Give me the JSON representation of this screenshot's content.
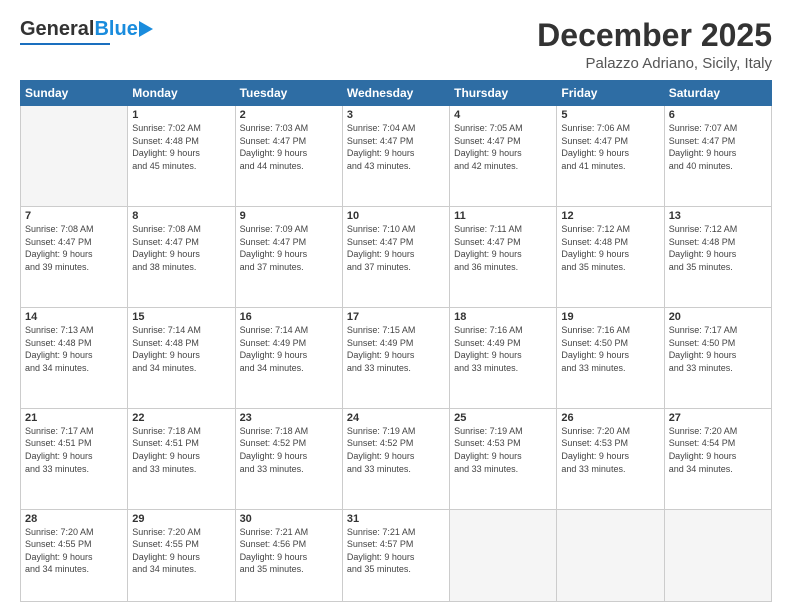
{
  "header": {
    "logo_general": "General",
    "logo_blue": "Blue",
    "month_title": "December 2025",
    "subtitle": "Palazzo Adriano, Sicily, Italy"
  },
  "calendar": {
    "days_of_week": [
      "Sunday",
      "Monday",
      "Tuesday",
      "Wednesday",
      "Thursday",
      "Friday",
      "Saturday"
    ],
    "weeks": [
      [
        {
          "day": "",
          "info": ""
        },
        {
          "day": "1",
          "info": "Sunrise: 7:02 AM\nSunset: 4:48 PM\nDaylight: 9 hours\nand 45 minutes."
        },
        {
          "day": "2",
          "info": "Sunrise: 7:03 AM\nSunset: 4:47 PM\nDaylight: 9 hours\nand 44 minutes."
        },
        {
          "day": "3",
          "info": "Sunrise: 7:04 AM\nSunset: 4:47 PM\nDaylight: 9 hours\nand 43 minutes."
        },
        {
          "day": "4",
          "info": "Sunrise: 7:05 AM\nSunset: 4:47 PM\nDaylight: 9 hours\nand 42 minutes."
        },
        {
          "day": "5",
          "info": "Sunrise: 7:06 AM\nSunset: 4:47 PM\nDaylight: 9 hours\nand 41 minutes."
        },
        {
          "day": "6",
          "info": "Sunrise: 7:07 AM\nSunset: 4:47 PM\nDaylight: 9 hours\nand 40 minutes."
        }
      ],
      [
        {
          "day": "7",
          "info": "Sunrise: 7:08 AM\nSunset: 4:47 PM\nDaylight: 9 hours\nand 39 minutes."
        },
        {
          "day": "8",
          "info": "Sunrise: 7:08 AM\nSunset: 4:47 PM\nDaylight: 9 hours\nand 38 minutes."
        },
        {
          "day": "9",
          "info": "Sunrise: 7:09 AM\nSunset: 4:47 PM\nDaylight: 9 hours\nand 37 minutes."
        },
        {
          "day": "10",
          "info": "Sunrise: 7:10 AM\nSunset: 4:47 PM\nDaylight: 9 hours\nand 37 minutes."
        },
        {
          "day": "11",
          "info": "Sunrise: 7:11 AM\nSunset: 4:47 PM\nDaylight: 9 hours\nand 36 minutes."
        },
        {
          "day": "12",
          "info": "Sunrise: 7:12 AM\nSunset: 4:48 PM\nDaylight: 9 hours\nand 35 minutes."
        },
        {
          "day": "13",
          "info": "Sunrise: 7:12 AM\nSunset: 4:48 PM\nDaylight: 9 hours\nand 35 minutes."
        }
      ],
      [
        {
          "day": "14",
          "info": "Sunrise: 7:13 AM\nSunset: 4:48 PM\nDaylight: 9 hours\nand 34 minutes."
        },
        {
          "day": "15",
          "info": "Sunrise: 7:14 AM\nSunset: 4:48 PM\nDaylight: 9 hours\nand 34 minutes."
        },
        {
          "day": "16",
          "info": "Sunrise: 7:14 AM\nSunset: 4:49 PM\nDaylight: 9 hours\nand 34 minutes."
        },
        {
          "day": "17",
          "info": "Sunrise: 7:15 AM\nSunset: 4:49 PM\nDaylight: 9 hours\nand 33 minutes."
        },
        {
          "day": "18",
          "info": "Sunrise: 7:16 AM\nSunset: 4:49 PM\nDaylight: 9 hours\nand 33 minutes."
        },
        {
          "day": "19",
          "info": "Sunrise: 7:16 AM\nSunset: 4:50 PM\nDaylight: 9 hours\nand 33 minutes."
        },
        {
          "day": "20",
          "info": "Sunrise: 7:17 AM\nSunset: 4:50 PM\nDaylight: 9 hours\nand 33 minutes."
        }
      ],
      [
        {
          "day": "21",
          "info": "Sunrise: 7:17 AM\nSunset: 4:51 PM\nDaylight: 9 hours\nand 33 minutes."
        },
        {
          "day": "22",
          "info": "Sunrise: 7:18 AM\nSunset: 4:51 PM\nDaylight: 9 hours\nand 33 minutes."
        },
        {
          "day": "23",
          "info": "Sunrise: 7:18 AM\nSunset: 4:52 PM\nDaylight: 9 hours\nand 33 minutes."
        },
        {
          "day": "24",
          "info": "Sunrise: 7:19 AM\nSunset: 4:52 PM\nDaylight: 9 hours\nand 33 minutes."
        },
        {
          "day": "25",
          "info": "Sunrise: 7:19 AM\nSunset: 4:53 PM\nDaylight: 9 hours\nand 33 minutes."
        },
        {
          "day": "26",
          "info": "Sunrise: 7:20 AM\nSunset: 4:53 PM\nDaylight: 9 hours\nand 33 minutes."
        },
        {
          "day": "27",
          "info": "Sunrise: 7:20 AM\nSunset: 4:54 PM\nDaylight: 9 hours\nand 34 minutes."
        }
      ],
      [
        {
          "day": "28",
          "info": "Sunrise: 7:20 AM\nSunset: 4:55 PM\nDaylight: 9 hours\nand 34 minutes."
        },
        {
          "day": "29",
          "info": "Sunrise: 7:20 AM\nSunset: 4:55 PM\nDaylight: 9 hours\nand 34 minutes."
        },
        {
          "day": "30",
          "info": "Sunrise: 7:21 AM\nSunset: 4:56 PM\nDaylight: 9 hours\nand 35 minutes."
        },
        {
          "day": "31",
          "info": "Sunrise: 7:21 AM\nSunset: 4:57 PM\nDaylight: 9 hours\nand 35 minutes."
        },
        {
          "day": "",
          "info": ""
        },
        {
          "day": "",
          "info": ""
        },
        {
          "day": "",
          "info": ""
        }
      ]
    ]
  }
}
